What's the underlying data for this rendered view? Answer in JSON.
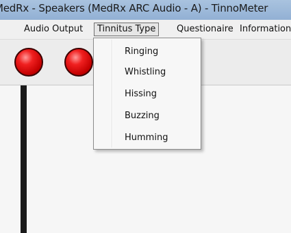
{
  "window": {
    "title": "MedRx - Speakers (MedRx ARC Audio - A) - TinnoMeter"
  },
  "menubar": {
    "items": [
      "Audio Output",
      "Tinnitus Type",
      "Questionaire",
      "Information"
    ]
  },
  "toolbar": {
    "indicators": [
      "red-indicator-light",
      "red-indicator-light"
    ]
  },
  "tinnitus_menu": {
    "items": [
      "Ringing",
      "Whistling",
      "Hissing",
      "Buzzing",
      "Humming"
    ]
  },
  "colors": {
    "indicator": "#e00000",
    "titlebar": "#a9c3df",
    "menu_background": "#f0f0f0"
  }
}
